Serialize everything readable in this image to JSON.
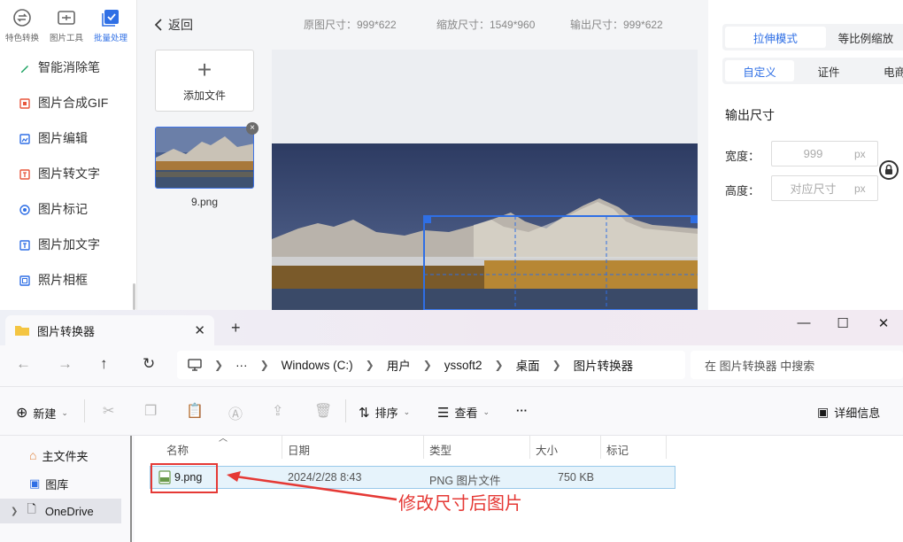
{
  "app": {
    "topnav": [
      {
        "label": "特色转换"
      },
      {
        "label": "图片工具"
      },
      {
        "label": "批量处理"
      }
    ],
    "sidebar": [
      {
        "label": "智能消除笔",
        "icon": "eraser-icon",
        "color": "#1aa260"
      },
      {
        "label": "图片合成GIF",
        "icon": "gif-icon",
        "color": "#e8563c"
      },
      {
        "label": "图片编辑",
        "icon": "edit-image-icon",
        "color": "#2f6fe5"
      },
      {
        "label": "图片转文字",
        "icon": "ocr-icon",
        "color": "#e8563c"
      },
      {
        "label": "图片标记",
        "icon": "mark-icon",
        "color": "#2f6fe5"
      },
      {
        "label": "图片加文字",
        "icon": "add-text-icon",
        "color": "#2f6fe5"
      },
      {
        "label": "照片相框",
        "icon": "frame-icon",
        "color": "#2f6fe5"
      }
    ],
    "back_label": "返回",
    "original_size": "原图尺寸：999*622",
    "scaled_size": "缩放尺寸：1549*960",
    "output_size": "输出尺寸：999*622",
    "add_file_label": "添加文件",
    "thumb_name": "9.png",
    "mode_tabs": [
      {
        "label": "拉伸模式",
        "active": true
      },
      {
        "label": "等比例缩放",
        "active": false
      }
    ],
    "preset_tabs": [
      {
        "label": "自定义",
        "active": true
      },
      {
        "label": "证件",
        "active": false
      },
      {
        "label": "电商",
        "active": false
      }
    ],
    "output_title": "输出尺寸",
    "width_label": "宽度：",
    "width_value": "999",
    "height_label": "高度：",
    "height_placeholder": "对应尺寸",
    "unit": "px"
  },
  "explorer": {
    "tab_title": "图片转换器",
    "address": [
      "Windows (C:)",
      "用户",
      "yssoft2",
      "桌面",
      "图片转换器"
    ],
    "search_placeholder": "在 图片转换器 中搜索",
    "toolbar": {
      "new_label": "新建",
      "sort_label": "排序",
      "view_label": "查看",
      "more_label": "···",
      "details_label": "详细信息"
    },
    "nav_items": [
      "主文件夹",
      "图库",
      "OneDrive"
    ],
    "columns": [
      "名称",
      "日期",
      "类型",
      "大小",
      "标记"
    ],
    "files": [
      {
        "name": "9.png",
        "date": "2024/2/28 8:43",
        "type": "PNG 图片文件",
        "size": "750 KB",
        "tag": ""
      }
    ],
    "annotation": "修改尺寸后图片",
    "highlight_color": "#e53935"
  }
}
